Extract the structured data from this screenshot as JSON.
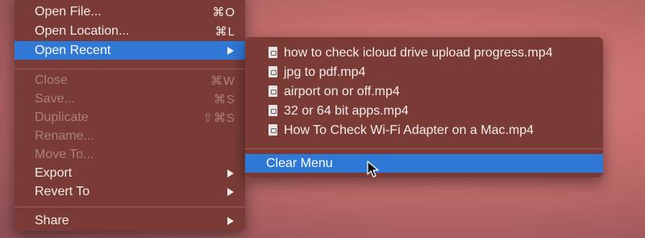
{
  "menu": {
    "items": [
      {
        "label": "Open File...",
        "shortcut": "⌘O"
      },
      {
        "label": "Open Location...",
        "shortcut": "⌘L"
      },
      {
        "label": "Open Recent"
      },
      {
        "label": "Close",
        "shortcut": "⌘W"
      },
      {
        "label": "Save...",
        "shortcut": "⌘S"
      },
      {
        "label": "Duplicate",
        "shortcut": "⇧⌘S"
      },
      {
        "label": "Rename..."
      },
      {
        "label": "Move To..."
      },
      {
        "label": "Export"
      },
      {
        "label": "Revert To"
      },
      {
        "label": "Share"
      }
    ]
  },
  "submenu": {
    "recent_files": [
      "how to check icloud drive upload progress.mp4",
      "jpg to pdf.mp4",
      "airport on or off.mp4",
      "32 or 64 bit apps.mp4",
      "How To Check Wi-Fi Adapter on a Mac.mp4"
    ],
    "clear_label": "Clear Menu"
  },
  "colors": {
    "menu_bg": "#7a3b36",
    "highlight": "#2f78d6",
    "text": "#f4ece9",
    "disabled_text": "#a9807b"
  }
}
